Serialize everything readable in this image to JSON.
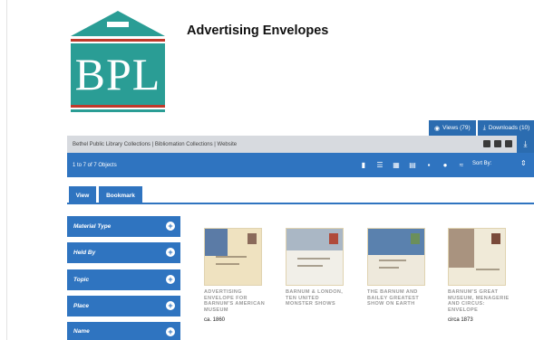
{
  "logo": {
    "text": "BPL"
  },
  "page_title": "Advertising Envelopes",
  "stats": {
    "views_label": "Views (79)",
    "downloads_label": "Downloads (10)"
  },
  "breadcrumb": "Bethel Public Library Collections | Bibliomation Collections | Website",
  "results": {
    "count_label": "1 to 7 of 7 Objects",
    "sort_label": "Sort By:"
  },
  "mode_tabs": [
    {
      "label": "View"
    },
    {
      "label": "Bookmark"
    }
  ],
  "facets": [
    {
      "label": "Material Type"
    },
    {
      "label": "Held By"
    },
    {
      "label": "Topic"
    },
    {
      "label": "Place"
    },
    {
      "label": "Name"
    }
  ],
  "items": [
    {
      "title": "ADVERTISING ENVELOPE FOR BARNUM'S AMERICAN MUSEUM",
      "date": "ca. 1860"
    },
    {
      "title": "BARNUM & LONDON, TEN UNITED MONSTER SHOWS",
      "date": ""
    },
    {
      "title": "THE BARNUM AND BAILEY GREATEST SHOW ON EARTH",
      "date": ""
    },
    {
      "title": "BARNUM'S GREAT MUSEUM, MENAGERIE AND CIRCUS: ENVELOPE",
      "date": "circa 1873"
    }
  ],
  "colors": {
    "accent": "#2f74c0",
    "logo_teal": "#2a9d95",
    "logo_red": "#c0392b"
  }
}
